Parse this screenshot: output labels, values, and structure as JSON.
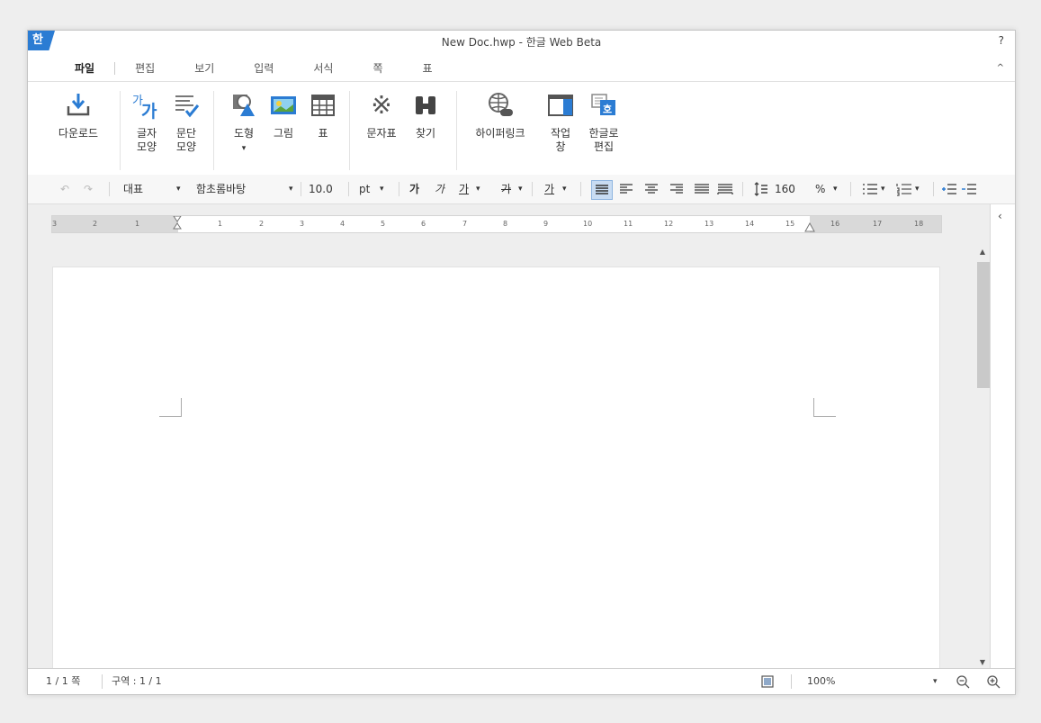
{
  "window": {
    "title": "New Doc.hwp - 한글 Web Beta",
    "logo": "한",
    "help": "?"
  },
  "menu": {
    "tabs": [
      "파일",
      "편집",
      "보기",
      "입력",
      "서식",
      "쪽",
      "표"
    ],
    "collapse": "^"
  },
  "ribbon": {
    "download": {
      "label": "다운로드",
      "icon": "download-icon"
    },
    "char_shape": {
      "line1": "글자",
      "line2": "모양",
      "icon": "char-shape-icon",
      "glyph_small": "가",
      "glyph_big": "가"
    },
    "para_shape": {
      "line1": "문단",
      "line2": "모양",
      "icon": "paragraph-shape-icon"
    },
    "shape": {
      "label": "도형",
      "dropdown": "▾",
      "icon": "shape-icon"
    },
    "picture": {
      "label": "그림",
      "icon": "picture-icon"
    },
    "table": {
      "label": "표",
      "icon": "table-icon"
    },
    "char_map": {
      "label": "문자표",
      "icon": "character-map-icon",
      "glyph": "※"
    },
    "find": {
      "label": "찾기",
      "icon": "binoculars-icon"
    },
    "hyperlink": {
      "label": "하이퍼링크",
      "icon": "hyperlink-globe-icon"
    },
    "task_pane": {
      "line1": "작업",
      "line2": "창",
      "icon": "task-pane-icon"
    },
    "edit_in_hangul": {
      "line1": "한글로",
      "line2": "편집",
      "icon": "edit-in-hangul-icon",
      "glyph": "호"
    }
  },
  "format_bar": {
    "undo": "↶",
    "redo": "↷",
    "style": "대표",
    "font": "함초롬바탕",
    "font_size": "10.0",
    "unit": "pt",
    "dropdown": "▾",
    "bold": "가",
    "italic": "가",
    "underline": "가",
    "strike": "가",
    "font_color": "가",
    "line_spacing_value": "160",
    "line_spacing_unit": "%"
  },
  "ruler": {
    "marks": [
      "3",
      "2",
      "1",
      "1",
      "2",
      "3",
      "4",
      "5",
      "6",
      "7",
      "8",
      "9",
      "10",
      "11",
      "12",
      "13",
      "14",
      "15",
      "16",
      "17",
      "18"
    ]
  },
  "status": {
    "page": "1 / 1 쪽",
    "section": "구역 : 1 / 1",
    "zoom": "100%",
    "zoom_dropdown": "▾"
  },
  "colors": {
    "accent": "#2b7cd3",
    "active_align": "#c8dcf3"
  }
}
